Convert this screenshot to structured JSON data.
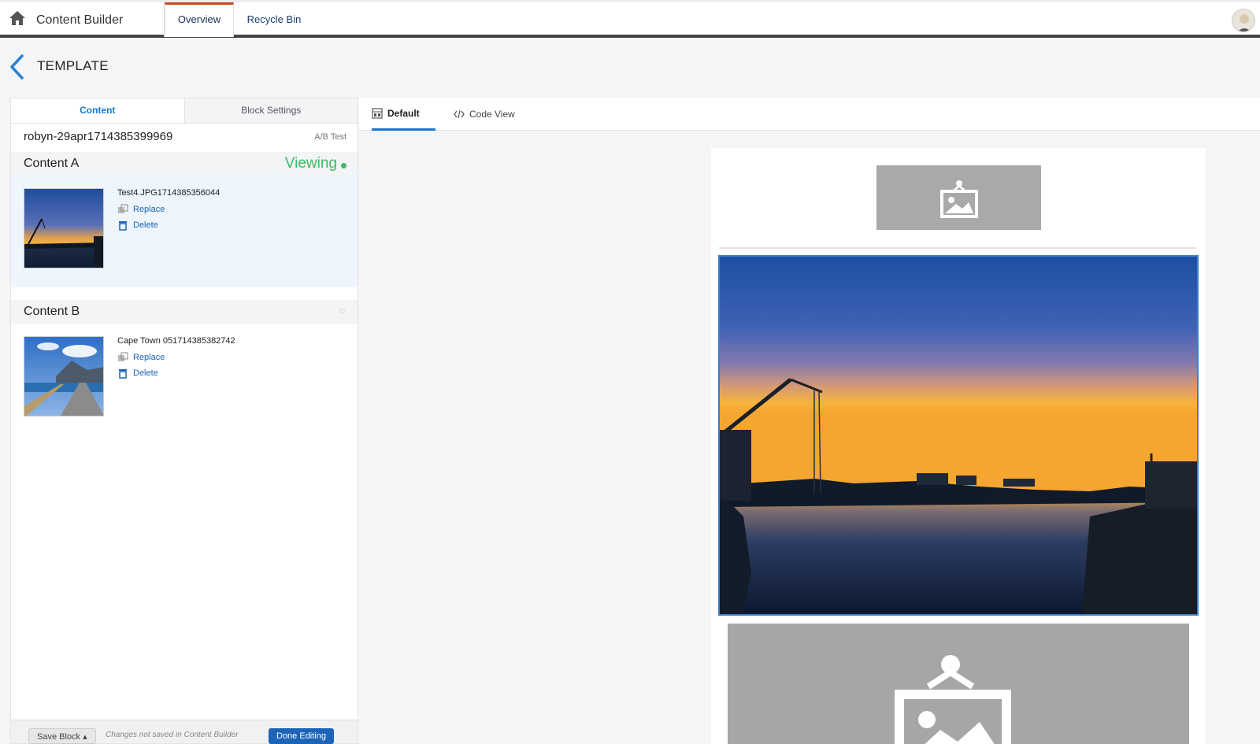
{
  "topbar": {
    "app_title": "Content Builder",
    "tabs": [
      {
        "label": "Overview",
        "active": true
      },
      {
        "label": "Recycle Bin",
        "active": false
      }
    ]
  },
  "header": {
    "title": "TEMPLATE"
  },
  "left_panel": {
    "tabs": [
      {
        "label": "Content",
        "active": true
      },
      {
        "label": "Block Settings",
        "active": false
      }
    ],
    "block_name": "robyn-29apr1714385399969",
    "ab_test_label": "A/B Test",
    "content_a": {
      "label": "Content A",
      "status": "Viewing",
      "file_name": "Test4.JPG1714385356044",
      "replace_label": "Replace",
      "delete_label": "Delete"
    },
    "content_b": {
      "label": "Content B",
      "file_name": "Cape Town 051714385382742",
      "replace_label": "Replace",
      "delete_label": "Delete"
    },
    "footer": {
      "save_label": "Save Block",
      "unsaved_note": "Changes not saved in Content Builder",
      "done_label": "Done Editing"
    }
  },
  "editor": {
    "tabs": [
      {
        "label": "Default",
        "active": true,
        "icon": "layout-icon"
      },
      {
        "label": "Code View",
        "active": false,
        "icon": "code-icon"
      }
    ]
  },
  "colors": {
    "accent": "#1b78c9",
    "viewing": "#3fb95f",
    "active_tab_top": "#c74a1f",
    "placeholder": "#a9a9a9"
  }
}
